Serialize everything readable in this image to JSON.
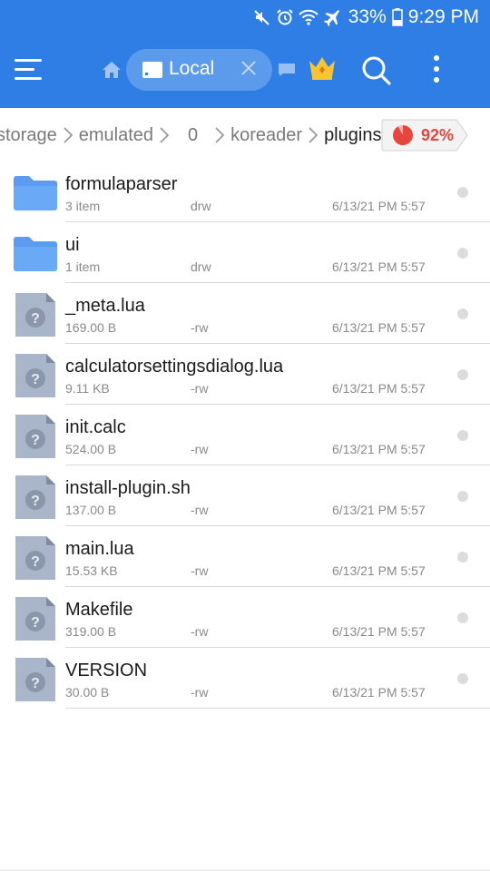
{
  "status_bar": {
    "battery": "33%",
    "time": "9:29 PM",
    "icons": [
      "mute-icon",
      "alarm-icon",
      "wifi-icon",
      "airplane-icon",
      "battery-icon"
    ]
  },
  "toolbar": {
    "tab_label": "Local",
    "icons": [
      "menu-icon",
      "home-icon",
      "storage-icon",
      "close-icon",
      "message-icon",
      "crown-icon",
      "search-icon",
      "more-vert-icon"
    ],
    "accent": "#2f7ee6"
  },
  "breadcrumb": {
    "items": [
      "storage",
      "emulated",
      "0",
      "koreader",
      "plugins"
    ],
    "storage_usage": 0.92,
    "storage_label": "92%"
  },
  "files": [
    {
      "name": "formulaparser",
      "size": "3 item",
      "perm": "drw",
      "date": "6/13/21 PM 5:57",
      "type": "folder"
    },
    {
      "name": "ui",
      "size": "1 item",
      "perm": "drw",
      "date": "6/13/21 PM 5:57",
      "type": "folder"
    },
    {
      "name": "_meta.lua",
      "size": "169.00 B",
      "perm": "-rw",
      "date": "6/13/21 PM 5:57",
      "type": "file"
    },
    {
      "name": "calculatorsettingsdialog.lua",
      "size": "9.11 KB",
      "perm": "-rw",
      "date": "6/13/21 PM 5:57",
      "type": "file"
    },
    {
      "name": "init.calc",
      "size": "524.00 B",
      "perm": "-rw",
      "date": "6/13/21 PM 5:57",
      "type": "file"
    },
    {
      "name": "install-plugin.sh",
      "size": "137.00 B",
      "perm": "-rw",
      "date": "6/13/21 PM 5:57",
      "type": "file"
    },
    {
      "name": "main.lua",
      "size": "15.53 KB",
      "perm": "-rw",
      "date": "6/13/21 PM 5:57",
      "type": "file"
    },
    {
      "name": "Makefile",
      "size": "319.00 B",
      "perm": "-rw",
      "date": "6/13/21 PM 5:57",
      "type": "file"
    },
    {
      "name": "VERSION",
      "size": "30.00 B",
      "perm": "-rw",
      "date": "6/13/21 PM 5:57",
      "type": "file"
    }
  ]
}
